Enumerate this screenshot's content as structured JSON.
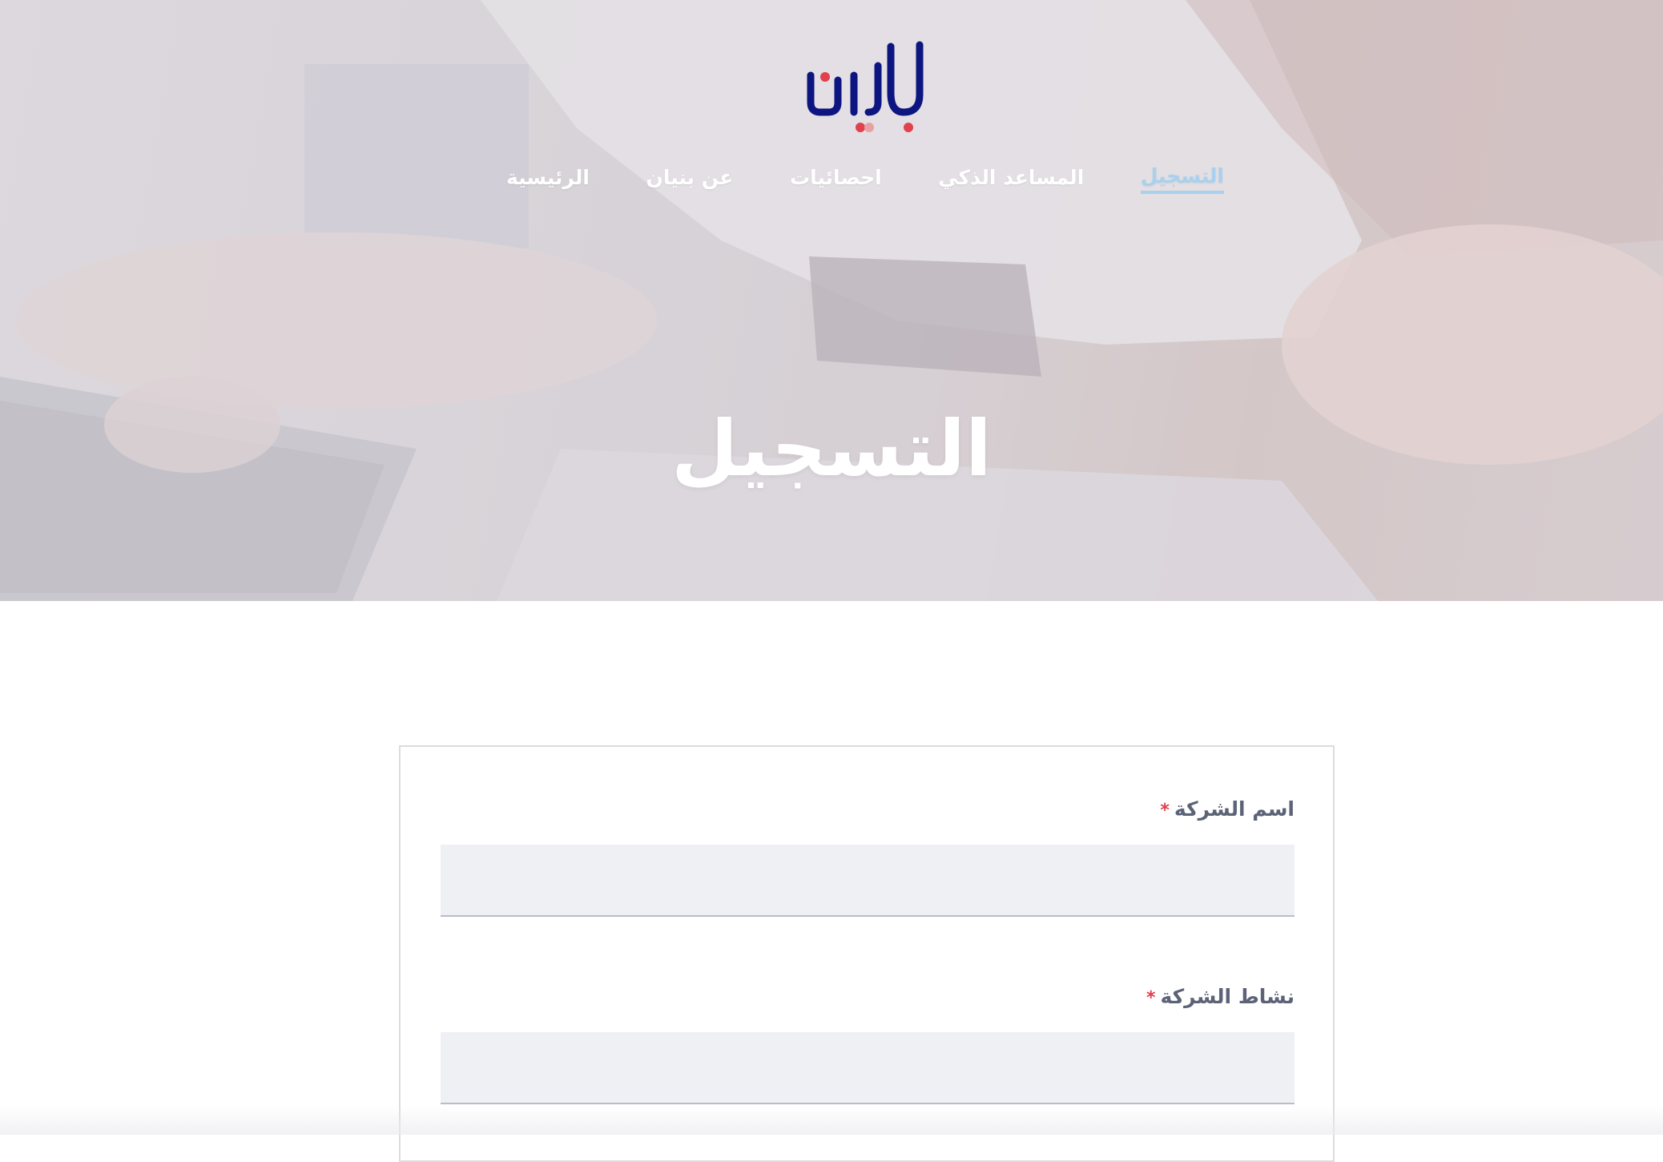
{
  "brand": {
    "logo_icon": "bunyan-logo",
    "logo_color": "#0d1680",
    "logo_dot_color": "#e0414c"
  },
  "nav": {
    "items": [
      {
        "label": "الرئيسية",
        "active": false
      },
      {
        "label": "عن بنيان",
        "active": false
      },
      {
        "label": "احصائيات",
        "active": false
      },
      {
        "label": "المساعد الذكي",
        "active": false
      },
      {
        "label": "التسجيل",
        "active": true
      }
    ],
    "active_color": "#a9d1ee"
  },
  "hero": {
    "title": "التسجيل"
  },
  "form": {
    "fields": [
      {
        "label": "اسم الشركة",
        "required_mark": "*",
        "value": "",
        "placeholder": ""
      },
      {
        "label": "نشاط الشركة",
        "required_mark": "*",
        "value": "",
        "placeholder": ""
      }
    ],
    "required_color": "#e0414c",
    "input_background": "#eff0f4"
  }
}
